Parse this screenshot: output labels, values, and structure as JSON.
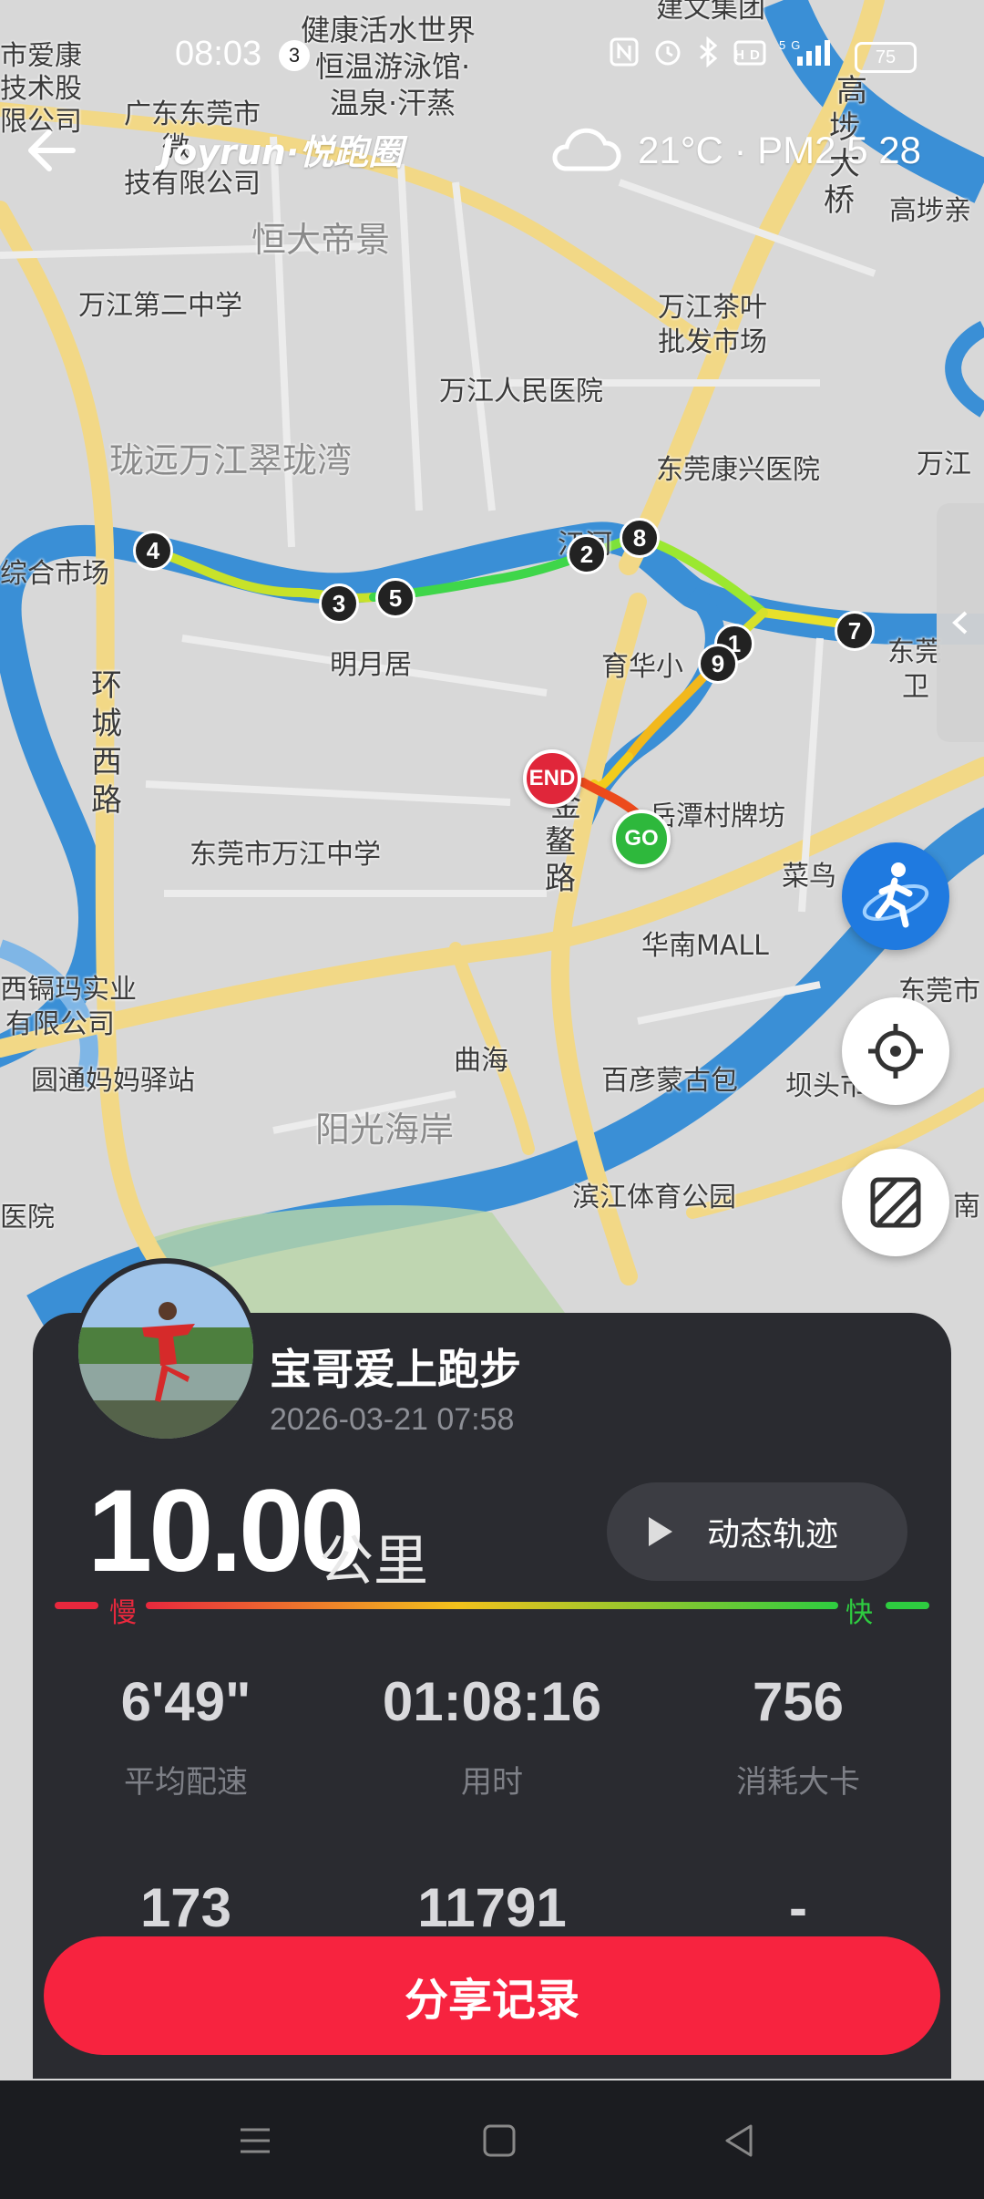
{
  "status_bar": {
    "time": "08:03",
    "notification_count": "3",
    "battery": "75"
  },
  "header": {
    "brand": "Joyrun·悦跑圈",
    "weather": "21°C · PM2.5 28"
  },
  "map": {
    "labels": [
      {
        "text": "健康活水世界",
        "size": "lg"
      },
      {
        "text": "恒温游泳馆·",
        "size": "lg"
      },
      {
        "text": "温泉·汗蒸",
        "size": "lg"
      },
      {
        "text": "市爱康",
        "size": "md"
      },
      {
        "text": "技术股",
        "size": "md"
      },
      {
        "text": "限公司",
        "size": "md"
      },
      {
        "text": "广东东莞市",
        "size": "md"
      },
      {
        "text": "微",
        "size": "md"
      },
      {
        "text": "技有限公司",
        "size": "md"
      },
      {
        "text": "恒大帝景",
        "size": "xl"
      },
      {
        "text": "万江第二中学",
        "size": "md"
      },
      {
        "text": "万江茶叶",
        "size": "md"
      },
      {
        "text": "批发市场",
        "size": "md"
      },
      {
        "text": "万江人民医院",
        "size": "md"
      },
      {
        "text": "东莞康兴医院",
        "size": "md"
      },
      {
        "text": "珑远万江翠珑湾",
        "size": "xl"
      },
      {
        "text": "综合市场",
        "size": "md"
      },
      {
        "text": "明月居",
        "size": "md"
      },
      {
        "text": "育华小",
        "size": "md"
      },
      {
        "text": "东莞",
        "size": "md"
      },
      {
        "text": "卫",
        "size": "md"
      },
      {
        "text": "环",
        "size": "road"
      },
      {
        "text": "城",
        "size": "road"
      },
      {
        "text": "西",
        "size": "road"
      },
      {
        "text": "路",
        "size": "road"
      },
      {
        "text": "东莞市万江中学",
        "size": "md"
      },
      {
        "text": "岳潭村牌坊",
        "size": "md"
      },
      {
        "text": "菜鸟",
        "size": "md"
      },
      {
        "text": "华南MALL",
        "size": "md"
      },
      {
        "text": "西镉玛实业",
        "size": "md"
      },
      {
        "text": "有限公司",
        "size": "md"
      },
      {
        "text": "圆通妈妈驿站",
        "size": "md"
      },
      {
        "text": "曲海",
        "size": "md"
      },
      {
        "text": "百彦蒙古包",
        "size": "md"
      },
      {
        "text": "阳光海岸",
        "size": "xl"
      },
      {
        "text": "坝头市场",
        "size": "md"
      },
      {
        "text": "滨江体育公园",
        "size": "md"
      },
      {
        "text": "医院",
        "size": "md"
      },
      {
        "text": "高埗亲",
        "size": "md"
      },
      {
        "text": "万江",
        "size": "md"
      },
      {
        "text": "东莞市",
        "size": "md"
      },
      {
        "text": "南",
        "size": "md"
      },
      {
        "text": "高",
        "size": "road"
      },
      {
        "text": "埗",
        "size": "road"
      },
      {
        "text": "大",
        "size": "road"
      },
      {
        "text": "桥",
        "size": "road"
      },
      {
        "text": "金",
        "size": "road"
      },
      {
        "text": "鳌",
        "size": "road"
      },
      {
        "text": "路",
        "size": "road"
      },
      {
        "text": "江河",
        "size": "md"
      },
      {
        "text": "建文集团",
        "size": "md"
      }
    ],
    "km_markers": [
      "1",
      "2",
      "3",
      "4",
      "5",
      "7",
      "8",
      "9"
    ],
    "start_label": "GO",
    "end_label": "END"
  },
  "profile": {
    "name": "宝哥爱上跑步",
    "datetime": "2026-03-21 07:58"
  },
  "distance": {
    "value": "10.00",
    "unit": "公里"
  },
  "replay_button": "动态轨迹",
  "pace_legend": {
    "slow": "慢",
    "fast": "快"
  },
  "stats": [
    {
      "value": "6'49\"",
      "label": "平均配速"
    },
    {
      "value": "01:08:16",
      "label": "用时"
    },
    {
      "value": "756",
      "label": "消耗大卡"
    },
    {
      "value": "173",
      "label": ""
    },
    {
      "value": "11791",
      "label": ""
    },
    {
      "value": "-",
      "label": ""
    }
  ],
  "share_button": "分享记录",
  "colors": {
    "accent": "#f7233f",
    "card": "#2a2b30",
    "river": "#3a8fd6",
    "road": "#f2d886",
    "fab_blue": "#1f7ae0"
  }
}
